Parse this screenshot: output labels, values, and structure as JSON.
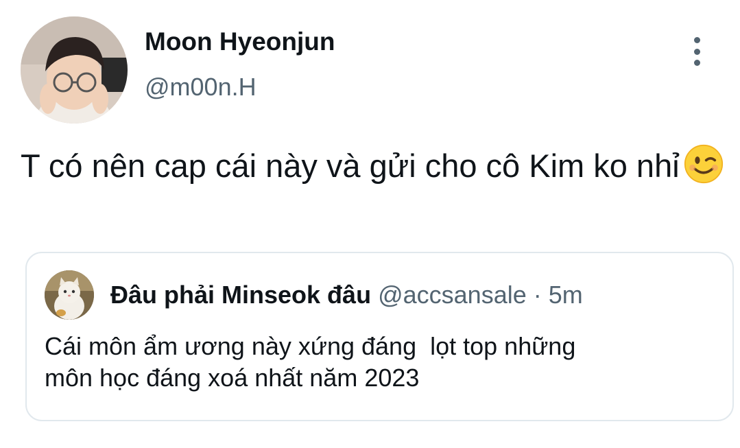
{
  "tweet": {
    "author": {
      "display_name": "Moon Hyeonjun",
      "handle": "@m00n.H",
      "avatar": "user-avatar-photo"
    },
    "text": "T có nên cap cái này và gửi cho cô Kim ko nhỉ",
    "emoji": "winking-face-emoji",
    "more_icon": "more-vertical-icon"
  },
  "quoted_tweet": {
    "author": {
      "display_name": "Đâu phải Minseok đâu",
      "handle": "@accsansale",
      "avatar": "cat-avatar-photo"
    },
    "separator": "·",
    "time": "5m",
    "text": "Cái môn ẩm ương này xứng đáng  lọt top những\nmôn học đáng xoá nhất năm 2023"
  },
  "colors": {
    "text_primary": "#0f1419",
    "text_secondary": "#536471",
    "border": "#e1e8ed",
    "background": "#ffffff"
  }
}
